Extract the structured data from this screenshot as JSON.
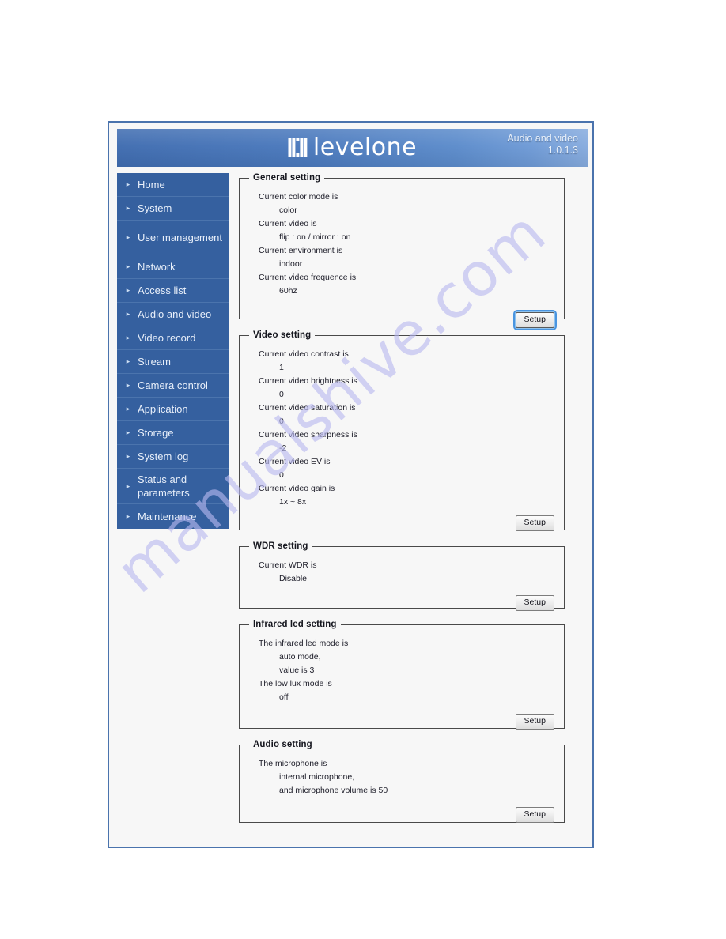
{
  "header": {
    "logo_word": "levelone",
    "logo_mark_icon": "levelone-pixel-logo-icon",
    "page_title": "Audio and video",
    "version": "1.0.1.3"
  },
  "sidebar": {
    "items": [
      {
        "label": "Home",
        "icon": "chevron-right-icon"
      },
      {
        "label": "System",
        "icon": "chevron-right-icon"
      },
      {
        "label": "User management",
        "icon": "chevron-right-icon"
      },
      {
        "label": "Network",
        "icon": "chevron-right-icon"
      },
      {
        "label": "Access list",
        "icon": "chevron-right-icon"
      },
      {
        "label": "Audio and video",
        "icon": "chevron-right-icon"
      },
      {
        "label": "Video record",
        "icon": "chevron-right-icon"
      },
      {
        "label": "Stream",
        "icon": "chevron-right-icon"
      },
      {
        "label": "Camera control",
        "icon": "chevron-right-icon"
      },
      {
        "label": "Application",
        "icon": "chevron-right-icon"
      },
      {
        "label": "Storage",
        "icon": "chevron-right-icon"
      },
      {
        "label": "System log",
        "icon": "chevron-right-icon"
      },
      {
        "label": "Status and parameters",
        "icon": "chevron-right-icon"
      },
      {
        "label": "Maintenance",
        "icon": "chevron-right-icon"
      }
    ]
  },
  "panels": {
    "general": {
      "legend": "General setting",
      "lines": [
        "Current color mode is",
        "color",
        "Current video is",
        "flip : on / mirror : on",
        "Current environment is",
        "indoor",
        "Current video frequence is",
        "60hz"
      ],
      "setup_label": "Setup"
    },
    "video": {
      "legend": "Video setting",
      "lines": [
        "Current video contrast is",
        "1",
        "Current video brightness is",
        "0",
        "Current video saturation is",
        "0",
        "Current video sharpness is",
        "-2",
        "Current video EV is",
        "0",
        "Current video gain is",
        "1x ~ 8x"
      ],
      "setup_label": "Setup"
    },
    "wdr": {
      "legend": "WDR setting",
      "lines": [
        "Current WDR is",
        "Disable"
      ],
      "setup_label": "Setup"
    },
    "infrared": {
      "legend": "Infrared led setting",
      "lines": [
        "The infrared led mode is",
        "auto mode,",
        "value is 3",
        "The low lux mode is",
        "off"
      ],
      "setup_label": "Setup"
    },
    "audio": {
      "legend": "Audio setting",
      "lines": [
        "The microphone is",
        "internal microphone,",
        "and microphone volume is 50"
      ],
      "setup_label": "Setup"
    }
  },
  "watermark": {
    "text": "manualshive.com"
  },
  "colors": {
    "sidebar_bg": "#35609f",
    "banner_start": "#3f6cb0",
    "banner_end": "#86abde",
    "frame_border": "#4a73ad",
    "content_bg": "#f7f7f7",
    "watermark": "#b9b9f0"
  }
}
